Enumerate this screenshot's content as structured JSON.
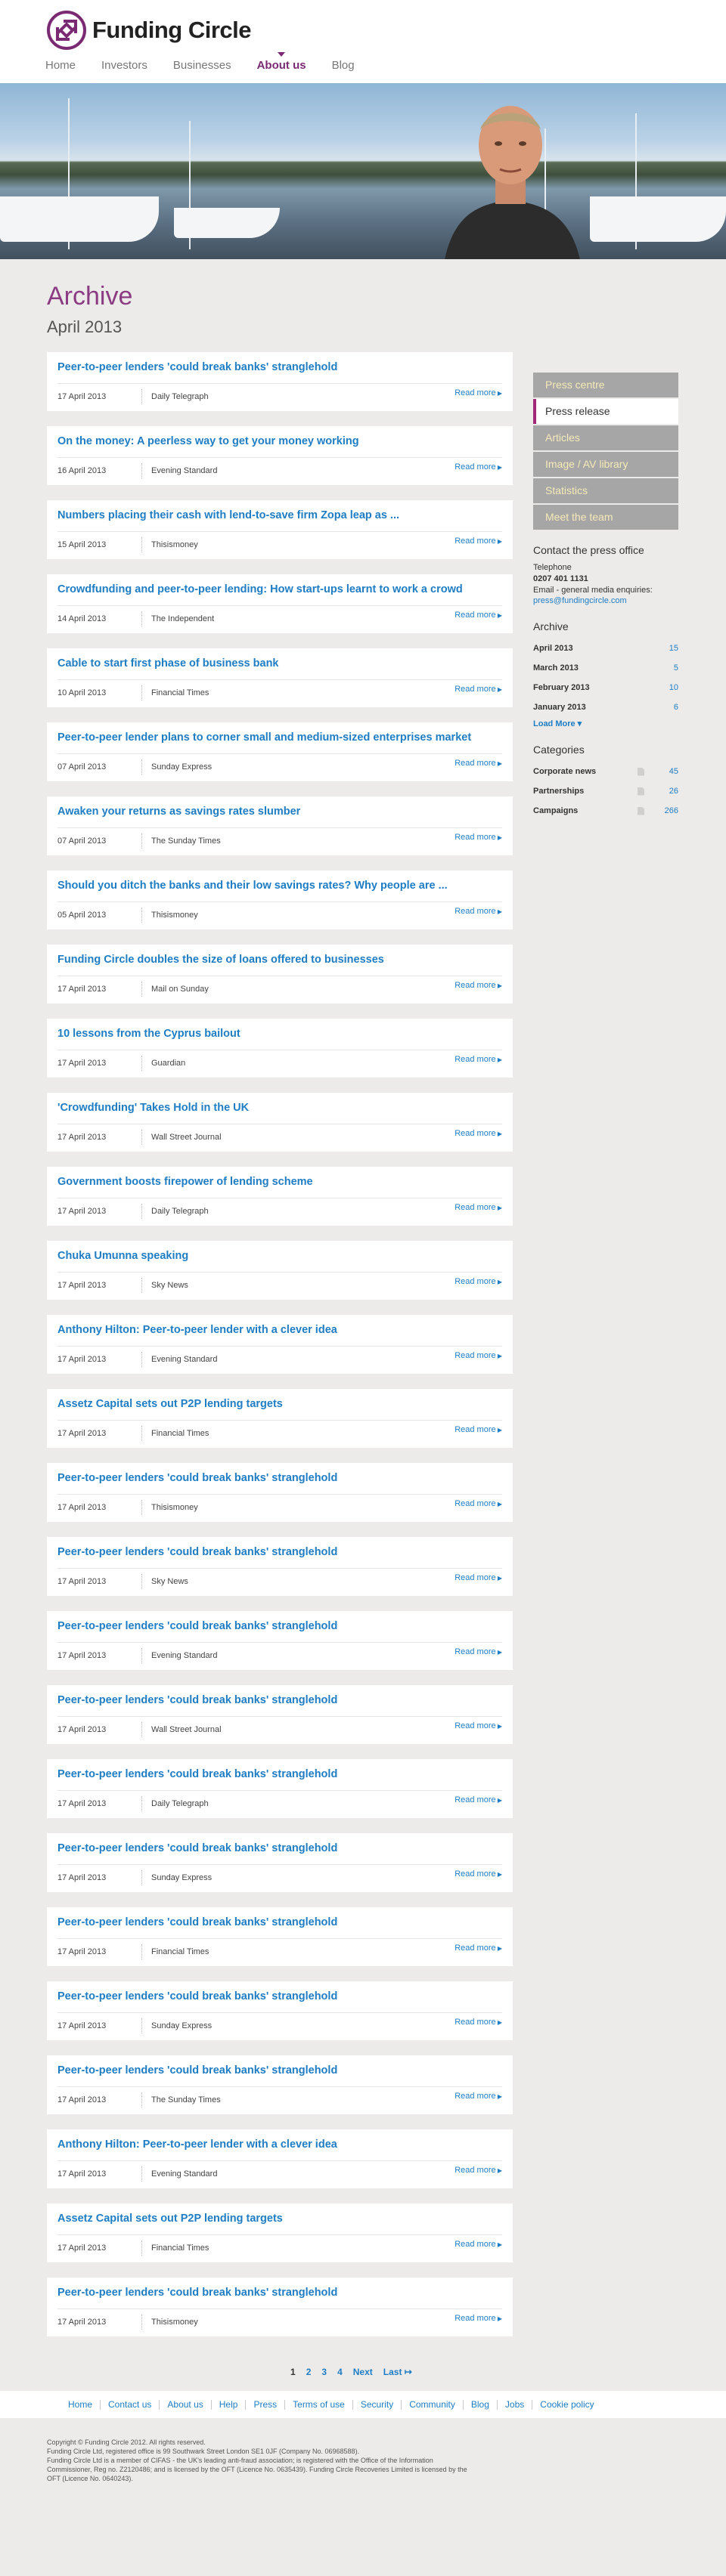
{
  "brand": {
    "name": "Funding Circle",
    "accent": "#7a2a73",
    "link": "#1f7dc4"
  },
  "nav": [
    {
      "label": "Home",
      "active": false
    },
    {
      "label": "Investors",
      "active": false
    },
    {
      "label": "Businesses",
      "active": false
    },
    {
      "label": "About us",
      "active": true
    },
    {
      "label": "Blog",
      "active": false
    }
  ],
  "page": {
    "title": "Archive",
    "subtitle": "April 2013"
  },
  "read_more": "Read more",
  "articles": [
    {
      "title": "Peer-to-peer lenders 'could break banks' stranglehold",
      "date": "17 April 2013",
      "source": "Daily Telegraph"
    },
    {
      "title": "On the money: A peerless way to get your money working",
      "date": "16 April 2013",
      "source": "Evening Standard"
    },
    {
      "title": "Numbers placing their cash with lend-to-save firm Zopa leap as ...",
      "date": "15 April 2013",
      "source": "Thisismoney"
    },
    {
      "title": "Crowdfunding and peer-to-peer lending: How start-ups learnt to work a crowd",
      "date": "14 April 2013",
      "source": "The Independent"
    },
    {
      "title": "Cable to start first phase of business bank",
      "date": "10 April 2013",
      "source": "Financial Times"
    },
    {
      "title": "Peer-to-peer lender plans to corner small and medium-sized enterprises market",
      "date": "07 April 2013",
      "source": "Sunday Express"
    },
    {
      "title": "Awaken your returns as savings rates slumber",
      "date": "07 April 2013",
      "source": "The Sunday Times"
    },
    {
      "title": "Should you ditch the banks and their low savings rates? Why people are ...",
      "date": "05 April 2013",
      "source": "Thisismoney"
    },
    {
      "title": "Funding Circle doubles the size of loans offered to businesses",
      "date": "17 April 2013",
      "source": "Mail on Sunday"
    },
    {
      "title": "10 lessons from the Cyprus bailout",
      "date": "17 April 2013",
      "source": "Guardian"
    },
    {
      "title": "'Crowdfunding' Takes Hold in the UK",
      "date": "17 April 2013",
      "source": "Wall Street Journal"
    },
    {
      "title": "Government boosts firepower of lending scheme",
      "date": "17 April 2013",
      "source": "Daily Telegraph"
    },
    {
      "title": "Chuka Umunna speaking",
      "date": "17 April 2013",
      "source": "Sky News"
    },
    {
      "title": "Anthony Hilton: Peer-to-peer lender with a clever idea",
      "date": "17 April 2013",
      "source": "Evening Standard"
    },
    {
      "title": "Assetz Capital sets out P2P lending targets",
      "date": "17 April 2013",
      "source": "Financial Times"
    },
    {
      "title": "Peer-to-peer lenders 'could break banks' stranglehold",
      "date": "17 April 2013",
      "source": "Thisismoney"
    },
    {
      "title": "Peer-to-peer lenders 'could break banks' stranglehold",
      "date": "17 April 2013",
      "source": "Sky News"
    },
    {
      "title": "Peer-to-peer lenders 'could break banks' stranglehold",
      "date": "17 April 2013",
      "source": "Evening Standard"
    },
    {
      "title": "Peer-to-peer lenders 'could break banks' stranglehold",
      "date": "17 April 2013",
      "source": "Wall Street Journal"
    },
    {
      "title": "Peer-to-peer lenders 'could break banks' stranglehold",
      "date": "17 April 2013",
      "source": "Daily Telegraph"
    },
    {
      "title": "Peer-to-peer lenders 'could break banks' stranglehold",
      "date": "17 April 2013",
      "source": "Sunday Express"
    },
    {
      "title": "Peer-to-peer lenders 'could break banks' stranglehold",
      "date": "17 April 2013",
      "source": "Financial Times"
    },
    {
      "title": "Peer-to-peer lenders 'could break banks' stranglehold",
      "date": "17 April 2013",
      "source": "Sunday Express"
    },
    {
      "title": "Peer-to-peer lenders 'could break banks' stranglehold",
      "date": "17 April 2013",
      "source": "The Sunday Times"
    },
    {
      "title": "Anthony Hilton: Peer-to-peer lender with a clever idea",
      "date": "17 April 2013",
      "source": "Evening Standard"
    },
    {
      "title": "Assetz Capital sets out P2P lending targets",
      "date": "17 April 2013",
      "source": "Financial Times"
    },
    {
      "title": "Peer-to-peer lenders 'could break banks' stranglehold",
      "date": "17 April 2013",
      "source": "Thisismoney"
    }
  ],
  "side_menu": [
    {
      "label": "Press centre",
      "active": false
    },
    {
      "label": "Press release",
      "active": true
    },
    {
      "label": "Articles",
      "active": false
    },
    {
      "label": "Image / AV library",
      "active": false
    },
    {
      "label": "Statistics",
      "active": false
    },
    {
      "label": "Meet the team",
      "active": false
    }
  ],
  "contact": {
    "heading": "Contact the press office",
    "phone_label": "Telephone",
    "phone": "0207 401 1131",
    "email_label": "Email - general media enquiries:",
    "email": "press@fundingcircle.com"
  },
  "archive": {
    "heading": "Archive",
    "items": [
      {
        "label": "April 2013",
        "count": "15"
      },
      {
        "label": "March 2013",
        "count": "5"
      },
      {
        "label": "February 2013",
        "count": "10"
      },
      {
        "label": "January 2013",
        "count": "6"
      }
    ],
    "load_more": "Load More ▾"
  },
  "categories": {
    "heading": "Categories",
    "items": [
      {
        "label": "Corporate news",
        "count": "45"
      },
      {
        "label": "Partnerships",
        "count": "26"
      },
      {
        "label": "Campaigns",
        "count": "266"
      }
    ]
  },
  "pagination": [
    "1",
    "2",
    "3",
    "4",
    "Next",
    "Last ↦"
  ],
  "footer_nav": [
    "Home",
    "Contact us",
    "About us",
    "Help",
    "Press",
    "Terms of use",
    "Security",
    "Community",
    "Blog",
    "Jobs",
    "Cookie policy"
  ],
  "legal": [
    "Copyright © Funding Circle 2012. All rights reserved.",
    "Funding Circle Ltd, registered office is 99 Southwark Street London SE1 0JF (Company No. 06968588).",
    "Funding Circle Ltd is a member of CIFAS - the UK's leading anti-fraud association; is registered with the Office of the Information",
    "Commissioner, Reg no. Z2120486; and is licensed by the OFT (Licence No. 0635439). Funding Circle Recoveries Limited is licensed by the",
    "OFT (Licence No. 0640243)."
  ]
}
